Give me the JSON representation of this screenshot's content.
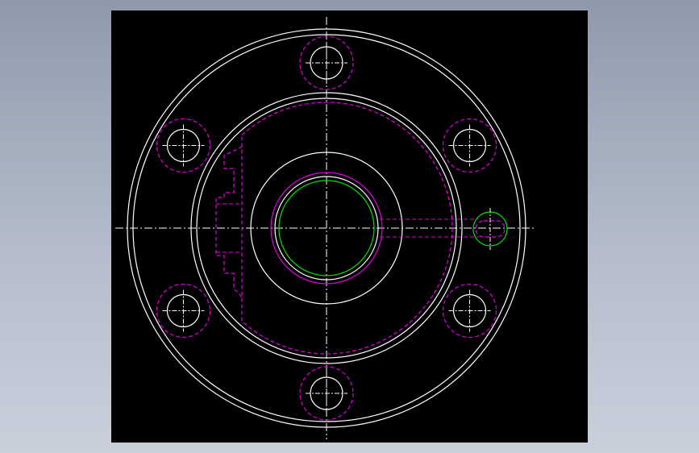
{
  "viewport": {
    "background": "#000000"
  },
  "colors": {
    "outline": "#ffffff",
    "hidden": "#e000e0",
    "centerline": "#ffffff",
    "bore": "#00e000",
    "pin": "#00e000"
  },
  "drawing": {
    "type": "cad-flange-top-view",
    "bolt_hole_count": 6,
    "features": [
      "outer-flange-circles",
      "raised-face-circles",
      "hub-circle",
      "bore-circle",
      "hidden-recess-outline",
      "hidden-slot",
      "pin-hole",
      "bolt-holes",
      "center-lines"
    ]
  }
}
